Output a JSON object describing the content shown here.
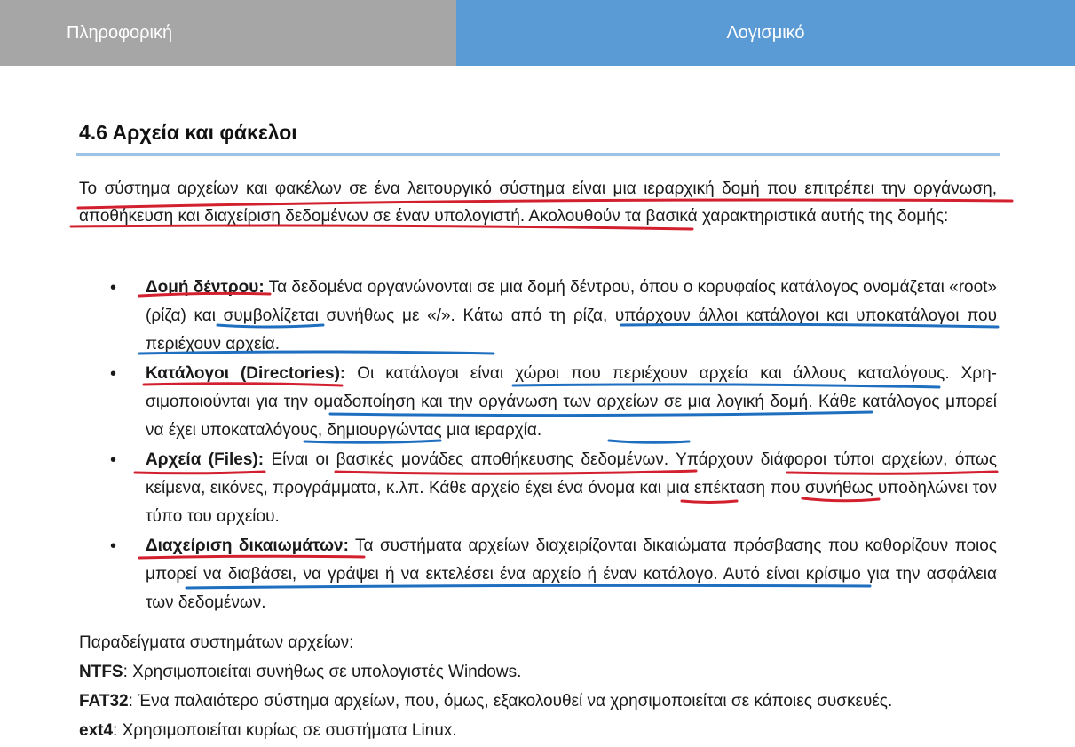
{
  "header": {
    "left": "Πληροφορική",
    "right": "Λογισμικό"
  },
  "section": {
    "title": "4.6 Αρχεία και φάκελοι",
    "intro": "Το σύστημα αρχείων και φακέλων σε ένα λειτουργικό σύστημα είναι μια ιεραρχική δομή που επιτρέπει την οργάνωση, αποθήκευση και διαχείριση δεδομένων σε έναν υπολογιστή. Ακολουθούν τα βασικά χαρακτηρι­στικά αυτής της δομής:"
  },
  "items": [
    {
      "label": "Δομή δέντρου:",
      "text": " Τα δεδομένα οργανώνονται σε μια δομή δέντρου, όπου ο κορυφαίος κατάλογος ονο­μάζεται «root» (ρίζα) και συμβολίζεται συνήθως με «/». Κάτω από τη ρίζα, υπάρχουν άλλοι κατάλογοι και υποκατάλογοι που περιέχουν αρχεία."
    },
    {
      "label": "Κατάλογοι (Directories):",
      "text": " Οι κατάλογοι είναι χώροι που περιέχουν αρχεία και άλλους καταλόγους. Χρη­σιμοποιούνται για την ομαδοποίηση και την οργάνωση των αρχείων σε μια λογική δομή. Κάθε κατάλο­γος μπορεί να έχει υποκαταλόγους, δημιουργώντας μια ιεραρχία."
    },
    {
      "label": "Αρχεία (Files):",
      "text": " Είναι οι βασικές μονάδες αποθήκευσης δεδομένων. Υπάρχουν διάφοροι τύποι αρχείων, όπως κείμενα, εικόνες, προγράμματα, κ.λπ. Κάθε αρχείο έχει ένα όνομα και μια επέκταση που συνήθως υποδηλώνει τον τύπο του αρχείου."
    },
    {
      "label": "Διαχείριση δικαιωμάτων:",
      "text": " Τα συστήματα αρχείων διαχειρίζονται δικαιώματα πρόσβασης που καθορί­ζουν ποιος μπορεί να διαβάσει, να γράψει ή να εκτελέσει ένα αρχείο ή έναν κατάλογο. Αυτό είναι κρί­σιμο για την ασφάλεια των δεδομένων."
    }
  ],
  "examples": {
    "heading": "Παραδείγματα συστημάτων αρχείων:",
    "list": [
      {
        "name": "NTFS",
        "text": ": Χρησιμοποιείται συνήθως σε υπολογιστές Windows."
      },
      {
        "name": "FAT32",
        "text": ": Ένα παλαιότερο σύστημα αρχείων, που, όμως, εξακολουθεί να χρησιμοποιείται σε κάποιες συσκευές."
      },
      {
        "name": "ext4",
        "text": ": Χρησιμοποιείται κυρίως σε συστήματα Linux."
      }
    ]
  },
  "colors": {
    "header_left_bg": "#a6a6a6",
    "header_right_bg": "#5b9bd5",
    "title_rule": "#9dc3e6",
    "annotation_red": "#d2202f",
    "annotation_blue": "#1f6fc0"
  }
}
